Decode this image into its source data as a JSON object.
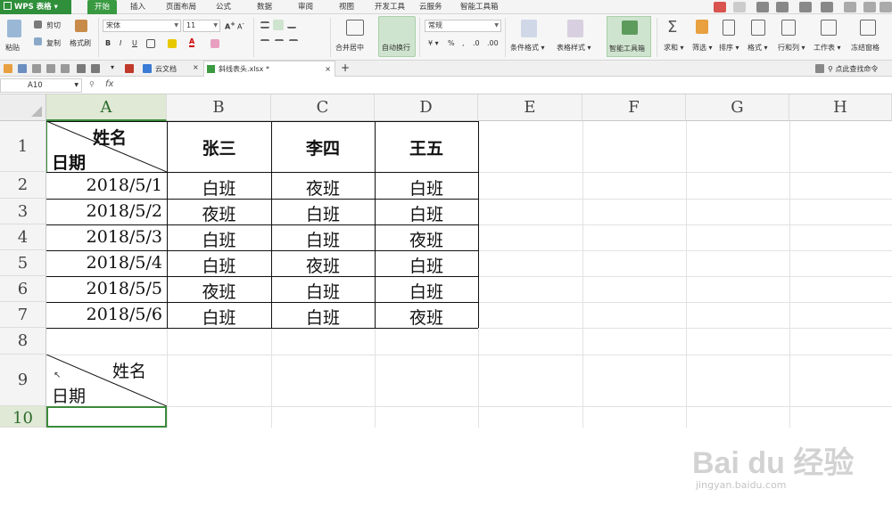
{
  "app": {
    "name": "WPS 表格"
  },
  "menu": {
    "tabs": [
      "开始",
      "插入",
      "页面布局",
      "公式",
      "数据",
      "审阅",
      "视图",
      "开发工具",
      "云服务",
      "智能工具箱"
    ]
  },
  "ribbon": {
    "paste": "粘贴",
    "cut": "剪切",
    "copy": "复制",
    "format_painter": "格式刷",
    "font_name": "宋体",
    "font_size": "11",
    "bold": "B",
    "italic": "I",
    "underline": "U",
    "merge_center": "合并居中",
    "auto_wrap": "自动换行",
    "number_format": "常规",
    "conditional_format": "条件格式",
    "table_style": "表格样式",
    "smart_toolbox": "智能工具箱",
    "sum": "求和",
    "filter": "筛选",
    "sort": "排序",
    "format": "格式",
    "row_col": "行和列",
    "worksheet": "工作表",
    "freeze": "冻结窗格"
  },
  "quickbar": {
    "cloud_doc": "云文档",
    "file_tab": "斜线表头.xlsx *",
    "find_cmd": "点此查找命令"
  },
  "formula_bar": {
    "cell_ref": "A10",
    "fx": "fx",
    "content": ""
  },
  "sheet": {
    "columns": [
      "A",
      "B",
      "C",
      "D",
      "E",
      "F",
      "G",
      "H"
    ],
    "rows": [
      "1",
      "2",
      "3",
      "4",
      "5",
      "6",
      "7",
      "8",
      "9",
      "10"
    ],
    "header_cell": {
      "top_right": "姓名",
      "bottom_left": "日期"
    },
    "names": [
      "张三",
      "李四",
      "王五"
    ],
    "dates": [
      "2018/5/1",
      "2018/5/2",
      "2018/5/3",
      "2018/5/4",
      "2018/5/5",
      "2018/5/6"
    ],
    "shifts": [
      [
        "白班",
        "夜班",
        "白班"
      ],
      [
        "夜班",
        "白班",
        "白班"
      ],
      [
        "白班",
        "白班",
        "夜班"
      ],
      [
        "白班",
        "夜班",
        "白班"
      ],
      [
        "夜班",
        "白班",
        "白班"
      ],
      [
        "白班",
        "白班",
        "夜班"
      ]
    ],
    "row9_header": {
      "top_right": "姓名",
      "bottom_left": "日期"
    }
  },
  "watermark": {
    "brand": "Bai du 经验",
    "url": "jingyan.baidu.com"
  },
  "colors": {
    "accent": "#3a9a42",
    "selection": "#dfe9d5"
  }
}
